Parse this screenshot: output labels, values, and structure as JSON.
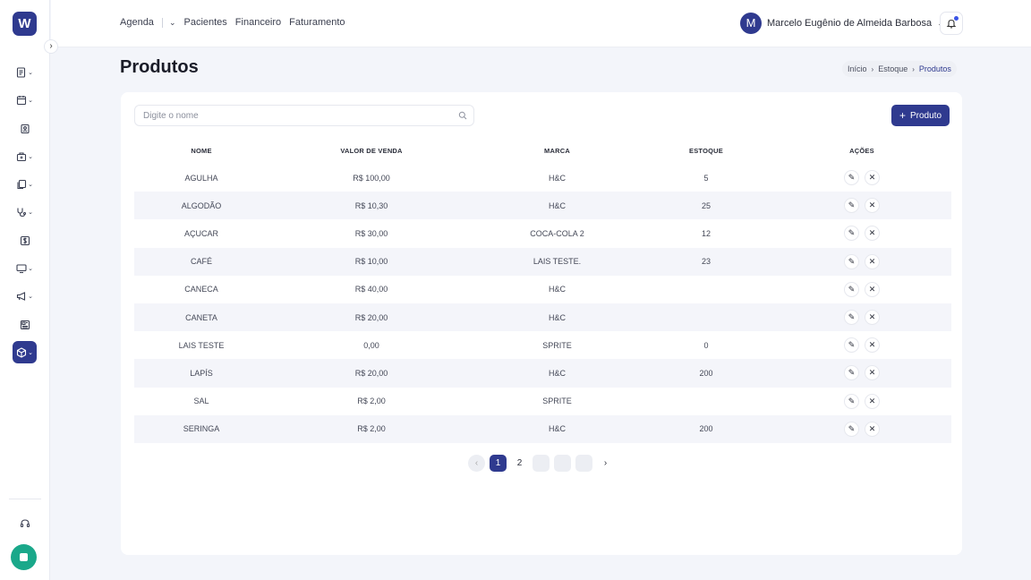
{
  "brand": {
    "logo_letter": "W"
  },
  "topnav": {
    "agenda": "Agenda",
    "pacientes": "Pacientes",
    "financeiro": "Financeiro",
    "faturamento": "Faturamento"
  },
  "user": {
    "initial": "M",
    "name": "Marcelo Eugênio de Almeida Barbosa"
  },
  "page": {
    "title": "Produtos"
  },
  "breadcrumb": [
    "Início",
    "Estoque",
    "Produtos"
  ],
  "search": {
    "placeholder": "Digite o nome"
  },
  "add_button": {
    "label": "Produto"
  },
  "table": {
    "headers": [
      "NOME",
      "VALOR DE VENDA",
      "MARCA",
      "ESTOQUE",
      "AÇÕES"
    ],
    "rows": [
      {
        "nome": "AGULHA",
        "valor": "R$ 100,00",
        "marca": "H&C",
        "estoque": "5"
      },
      {
        "nome": "ALGODÃO",
        "valor": "R$ 10,30",
        "marca": "H&C",
        "estoque": "25"
      },
      {
        "nome": "AÇUCAR",
        "valor": "R$ 30,00",
        "marca": "COCA-COLA 2",
        "estoque": "12"
      },
      {
        "nome": "CAFÉ",
        "valor": "R$ 10,00",
        "marca": "LAIS TESTE.",
        "estoque": "23"
      },
      {
        "nome": "CANECA",
        "valor": "R$ 40,00",
        "marca": "H&C",
        "estoque": ""
      },
      {
        "nome": "CANETA",
        "valor": "R$ 20,00",
        "marca": "H&C",
        "estoque": ""
      },
      {
        "nome": "LAIS TESTE",
        "valor": "0,00",
        "marca": "SPRITE",
        "estoque": "0"
      },
      {
        "nome": "LAPÍS",
        "valor": "R$ 20,00",
        "marca": "H&C",
        "estoque": "200"
      },
      {
        "nome": "SAL",
        "valor": "R$ 2,00",
        "marca": "SPRITE",
        "estoque": ""
      },
      {
        "nome": "SERINGA",
        "valor": "R$ 2,00",
        "marca": "H&C",
        "estoque": "200"
      }
    ]
  },
  "pagination": {
    "pages": [
      "1",
      "2"
    ],
    "current": "1"
  },
  "icons": {
    "sidebar": [
      "document-list-icon",
      "calendar-icon",
      "contact-card-icon",
      "clinic-icon",
      "files-icon",
      "stethoscope-icon",
      "dollar-icon",
      "monitor-icon",
      "megaphone-icon",
      "newspaper-icon",
      "box-icon"
    ],
    "footer": [
      "headset-icon",
      "chat-icon"
    ]
  },
  "colors": {
    "primary": "#2f3a8f",
    "chat": "#1aa88a",
    "notification": "#3b55e6"
  }
}
